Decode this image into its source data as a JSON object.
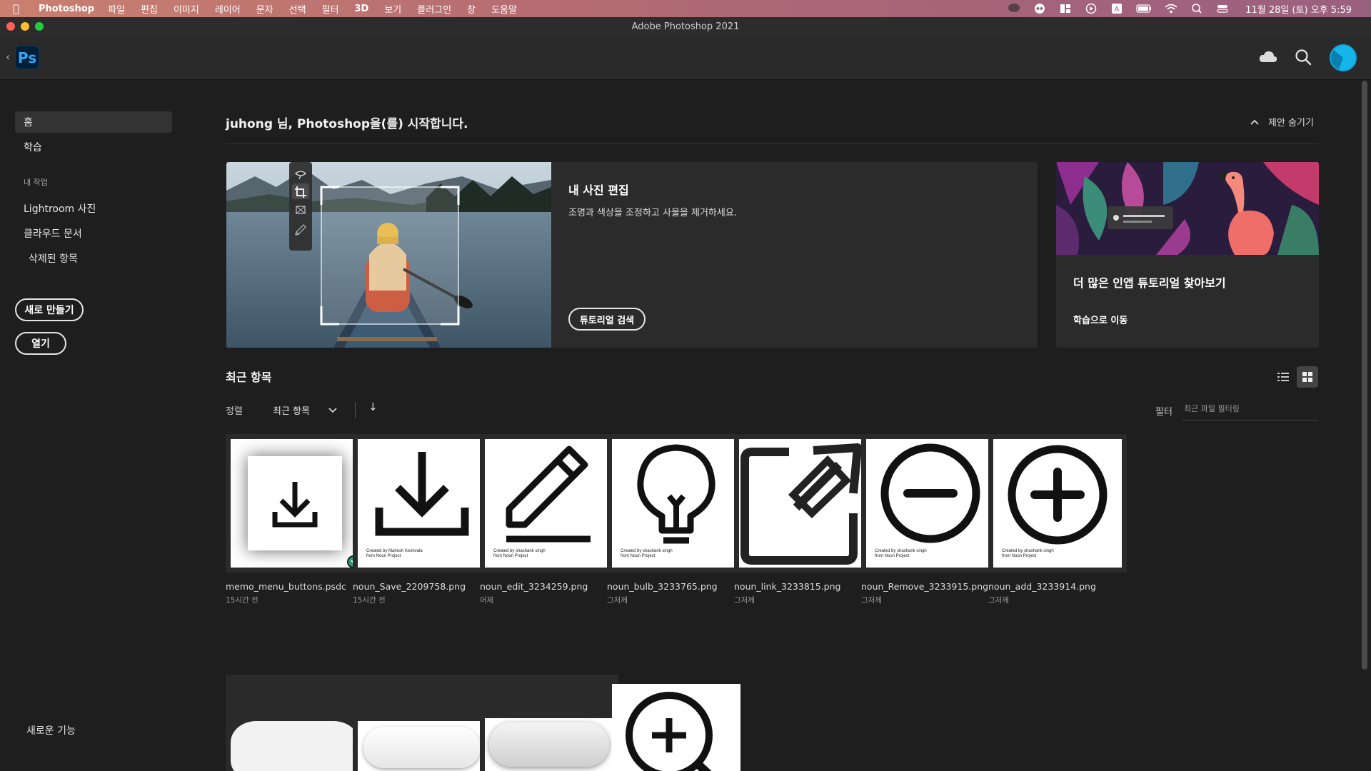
{
  "menubar": {
    "app_name": "Photoshop",
    "items": [
      "파일",
      "편집",
      "이미지",
      "레이어",
      "문자",
      "선택",
      "필터",
      "3D",
      "보기",
      "플러그인",
      "창",
      "도움말"
    ],
    "clock": "11월 28일 (토) 오후 5:59"
  },
  "window": {
    "title": "Adobe Photoshop 2021"
  },
  "header": {
    "logo_text": "Ps"
  },
  "sidebar": {
    "home": "홈",
    "learn": "학습",
    "my_work_heading": "내 작업",
    "lightroom": "Lightroom 사진",
    "cloud_docs": "클라우드 문서",
    "deleted": "삭제된 항목",
    "new_button": "새로 만들기",
    "open_button": "열기",
    "whats_new": "새로운 기능"
  },
  "main": {
    "welcome": "juhong 님, Photoshop을(를) 시작합니다.",
    "hide_suggestions": "제안 숨기기",
    "hero": {
      "title": "내 사진 편집",
      "description": "조명과 색상을 조정하고 사물을 제거하세요.",
      "button": "튜토리얼 검색"
    },
    "tutorials": {
      "title": "더 많은 인앱 튜토리얼 찾아보기",
      "link": "학습으로 이동"
    },
    "recent": {
      "title": "최근 항목",
      "sort_label": "정렬",
      "sort_value": "최근 항목",
      "sort_direction": "↓",
      "filter_label": "필터",
      "filter_placeholder": "최근 파일 필터링"
    }
  },
  "files": [
    {
      "name": "memo_menu_buttons.psdc",
      "time": "15시간 전",
      "icon": "download-icon",
      "credit": ""
    },
    {
      "name": "noun_Save_2209758.png",
      "time": "15시간 전",
      "icon": "download-icon",
      "credit": "Created by Mahesh Keshvala\nfrom Noun Project"
    },
    {
      "name": "noun_edit_3234259.png",
      "time": "어제",
      "icon": "pencil-icon",
      "credit": "Created by shashank singh\nfrom Noun Project"
    },
    {
      "name": "noun_bulb_3233765.png",
      "time": "그저께",
      "icon": "lightbulb-icon",
      "credit": "Created by shashank singh\nfrom Noun Project"
    },
    {
      "name": "noun_link_3233815.png",
      "time": "그저께",
      "icon": "external-link-icon",
      "credit": ""
    },
    {
      "name": "noun_Remove_3233915.png",
      "time": "그저께",
      "icon": "minus-circle-icon",
      "credit": "Created by shashank singh\nfrom Noun Project"
    },
    {
      "name": "noun_add_3233914.png",
      "time": "그저께",
      "icon": "plus-circle-icon",
      "credit": "Created by shashank singh\nfrom Noun Project"
    }
  ],
  "colors": {
    "accent": "#31a8ff",
    "background": "#1e1e1e",
    "card": "#2b2b2b",
    "synced_badge": "#2d9d78"
  }
}
